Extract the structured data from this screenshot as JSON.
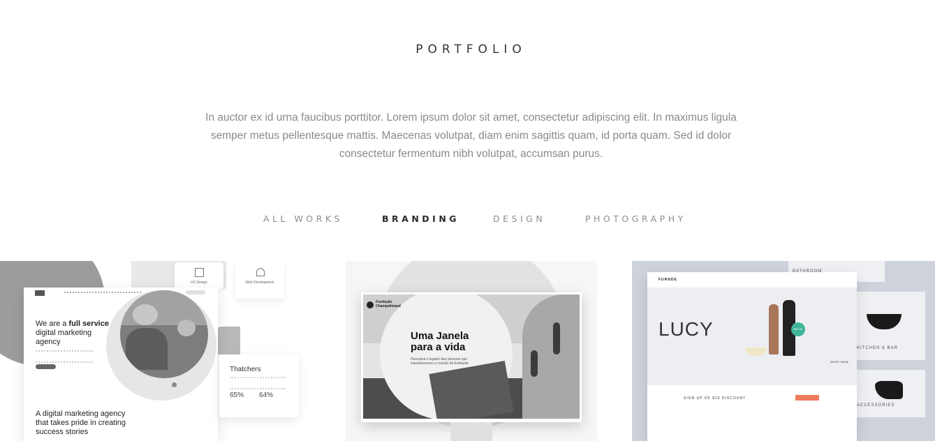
{
  "header": {
    "title": "PORTFOLIO",
    "intro": "In auctor ex id urna faucibus porttitor. Lorem ipsum dolor sit amet, consectetur adipiscing elit. In maximus ligula semper metus pellentesque mattis. Maecenas volutpat, diam enim sagittis quam, id porta quam. Sed id dolor consectetur fermentum nibh volutpat, accumsan purus."
  },
  "filters": [
    {
      "label": "ALL WORKS"
    },
    {
      "label": "BRANDING",
      "active": true
    },
    {
      "label": "DESIGN"
    },
    {
      "label": "PHOTOGRAPHY"
    }
  ],
  "items": [
    {
      "heading_pre": "We are a ",
      "heading_bold": "full service",
      "heading_post": " digital marketing agency",
      "card1": "UX Design",
      "card2": "Web Development",
      "side_title": "Thatchers",
      "stat1": "65%",
      "stat2": "64%",
      "tagline": "A digital marketing agency that takes pride in creating success stories"
    },
    {
      "brand": "Fundação Champalimaud",
      "headline": "Uma Janela para a vida",
      "sub": "Descubra o legado das pessoas que impulsionaram a criação da fundação"
    },
    {
      "logo": "FURNDE",
      "title": "LUCY",
      "badge": "$49.99",
      "cta": "SHOP NOW",
      "signup": "SIGN UP OF $20 DISCOUNT",
      "side1": "BATHROOM",
      "side2": "KITCHEN & BAR",
      "side3": "ACCESSORIES"
    }
  ]
}
